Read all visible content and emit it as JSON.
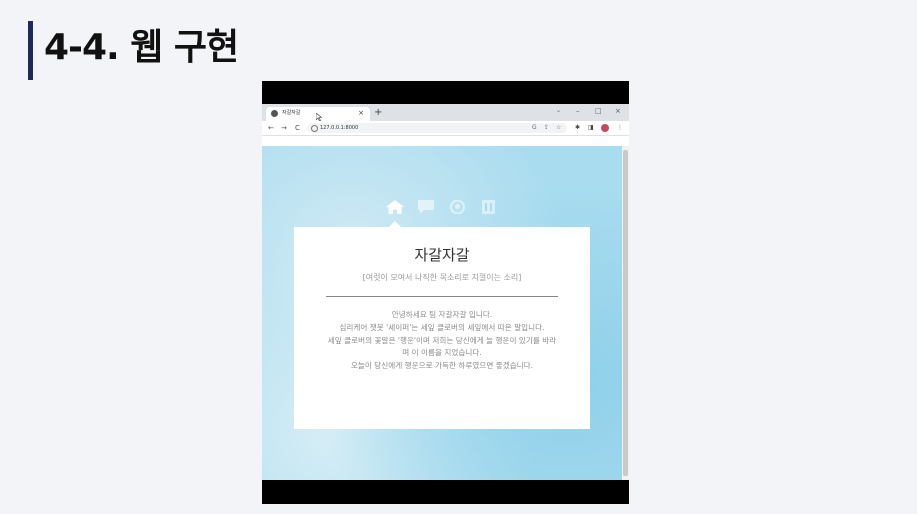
{
  "slide": {
    "title": "4-4. 웹 구현"
  },
  "browser": {
    "tab_title": "자갈자갈",
    "tab_close": "×",
    "new_tab": "+",
    "tab_dropdown": "⌄",
    "minimize": "–",
    "maximize": "□",
    "close": "×",
    "back": "←",
    "forward": "→",
    "reload": "C",
    "url": "127.0.0.1:8000",
    "google_lens": "G",
    "share": "⇪",
    "bookmark": "☆",
    "extensions": "✱",
    "side_panel": "◨",
    "menu": "⋮"
  },
  "page": {
    "title": "자갈자갈",
    "subtitle": "[여럿이 모여서 나직한 목소리로 지껄이는 소리]",
    "paragraphs": [
      "안녕하세요 팀 자갈자갈 입니다.",
      "심리케어 챗봇 '세이퍼'는 세잎 클로버의 세잎에서 따온 말입니다.",
      "세잎 클로버의 꽃말은 '행운'이며 저희는 당신에게 늘 행운이 있기를 바라며 이 이름을 지었습니다.",
      "오늘이 당신에게 행운으로 가득한 하루였으면 좋겠습니다."
    ],
    "nav_icons": [
      "home-icon",
      "chat-icon",
      "github-icon",
      "document-icon"
    ]
  },
  "colors": {
    "accent_bar": "#1e2a5e",
    "sky": "#a9dcef",
    "card": "#ffffff"
  }
}
